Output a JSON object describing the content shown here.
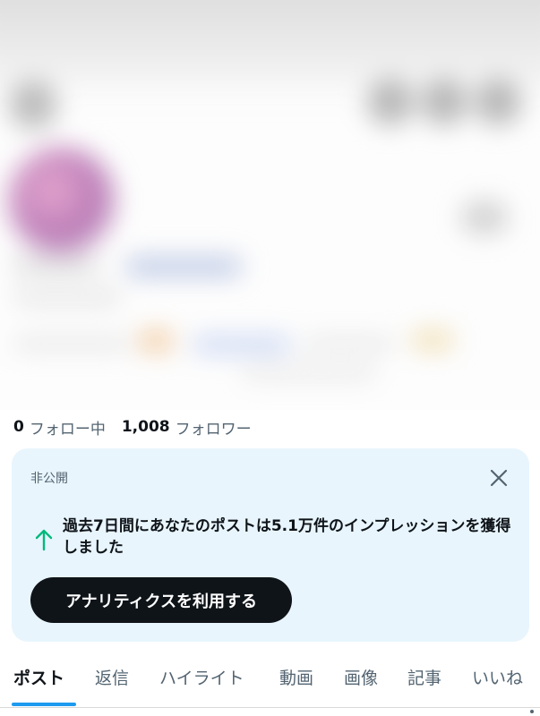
{
  "profile": {
    "following_count": "0",
    "following_label": "フォロー中",
    "followers_count": "1,008",
    "followers_label": "フォロワー"
  },
  "analytics_card": {
    "visibility_label": "非公開",
    "close_icon": "close-icon",
    "trend_icon": "arrow-up-icon",
    "message": "過去7日間にあなたのポストは5.1万件のインプレッションを獲得しました",
    "cta_label": "アナリティクスを利用する",
    "colors": {
      "background": "#e8f5fd",
      "trend": "#00ba7c",
      "cta_background": "#0f1419"
    }
  },
  "tabs": {
    "active_index": 0,
    "items": [
      {
        "label": "ポスト"
      },
      {
        "label": "返信"
      },
      {
        "label": "ハイライト"
      },
      {
        "label": "動画"
      },
      {
        "label": "画像"
      },
      {
        "label": "記事"
      },
      {
        "label": "いいね"
      }
    ],
    "indicator_color": "#1d9bf0"
  }
}
